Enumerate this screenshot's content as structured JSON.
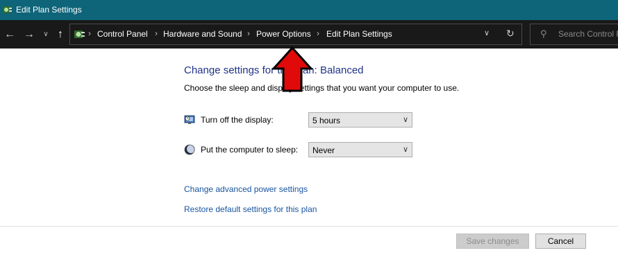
{
  "window": {
    "title": "Edit Plan Settings"
  },
  "address_bar": {
    "breadcrumbs": [
      "Control Panel",
      "Hardware and Sound",
      "Power Options",
      "Edit Plan Settings"
    ]
  },
  "search": {
    "placeholder": "Search Control Panel"
  },
  "main": {
    "heading": "Change settings for the plan: Balanced",
    "description": "Choose the sleep and display settings that you want your computer to use.",
    "settings": [
      {
        "label": "Turn off the display:",
        "value": "5 hours"
      },
      {
        "label": "Put the computer to sleep:",
        "value": "Never"
      }
    ],
    "links": {
      "advanced": "Change advanced power settings",
      "restore": "Restore default settings for this plan"
    }
  },
  "footer": {
    "save_label": "Save changes",
    "cancel_label": "Cancel"
  },
  "colors": {
    "titlebar": "#0e6478",
    "navbar": "#191919",
    "heading": "#1e3287",
    "link": "#1a55a0",
    "annotation_arrow": "#e10a0a"
  },
  "icons": {
    "title": "power-options-icon",
    "address": "power-options-icon",
    "display_setting": "monitor-clock-icon",
    "sleep_setting": "moon-icon"
  }
}
